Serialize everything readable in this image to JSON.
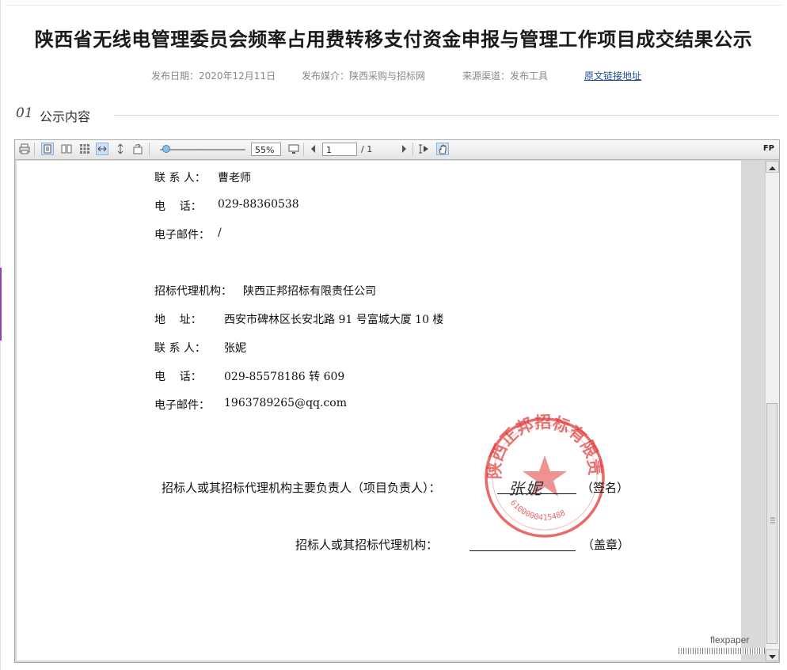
{
  "article": {
    "title": "陕西省无线电管理委员会频率占用费转移支付资金申报与管理工作项目成交结果公示",
    "publish_date": "发布日期：2020年12月11日",
    "publish_media": "发布媒介：陕西采购与招标网",
    "source": "来源渠道：发布工具",
    "source_link": "原文链接地址"
  },
  "section": {
    "number": "01",
    "label": "公示内容"
  },
  "viewer": {
    "toolbar": {
      "print_icon": "print-icon",
      "zoom_value": "55%",
      "page_current": "1",
      "page_total": "/ 1",
      "brand": "FP"
    },
    "document": {
      "contact_label_1": "联 系 人：",
      "contact_value_1": "曹老师",
      "phone_label_1": "电    话：",
      "phone_value_1": "029-88360538",
      "email_label_1": "电子邮件：",
      "email_value_1": "/",
      "agency_label": "招标代理机构：",
      "agency_value": "陕西正邦招标有限责任公司",
      "address_label": "地    址：",
      "address_value": "西安市碑林区长安北路 91 号富城大厦 10 楼",
      "contact_label_2": "联 系 人：",
      "contact_value_2": "张妮",
      "phone_label_2": "电    话：",
      "phone_value_2": "029-85578186 转 609",
      "email_label_2": "电子邮件：",
      "email_value_2": "1963789265@qq.com",
      "sign_line_1": "招标人或其招标代理机构主要负责人（项目负责人）：",
      "signature": "张妮",
      "sign_suffix_1": "（签名）",
      "sign_line_2": "招标人或其招标代理机构：",
      "sign_suffix_2": "（盖章）",
      "stamp_text": "陕西正邦招标有限责任公司",
      "stamp_code": "6100000415488",
      "watermark": "flexpaper"
    }
  }
}
